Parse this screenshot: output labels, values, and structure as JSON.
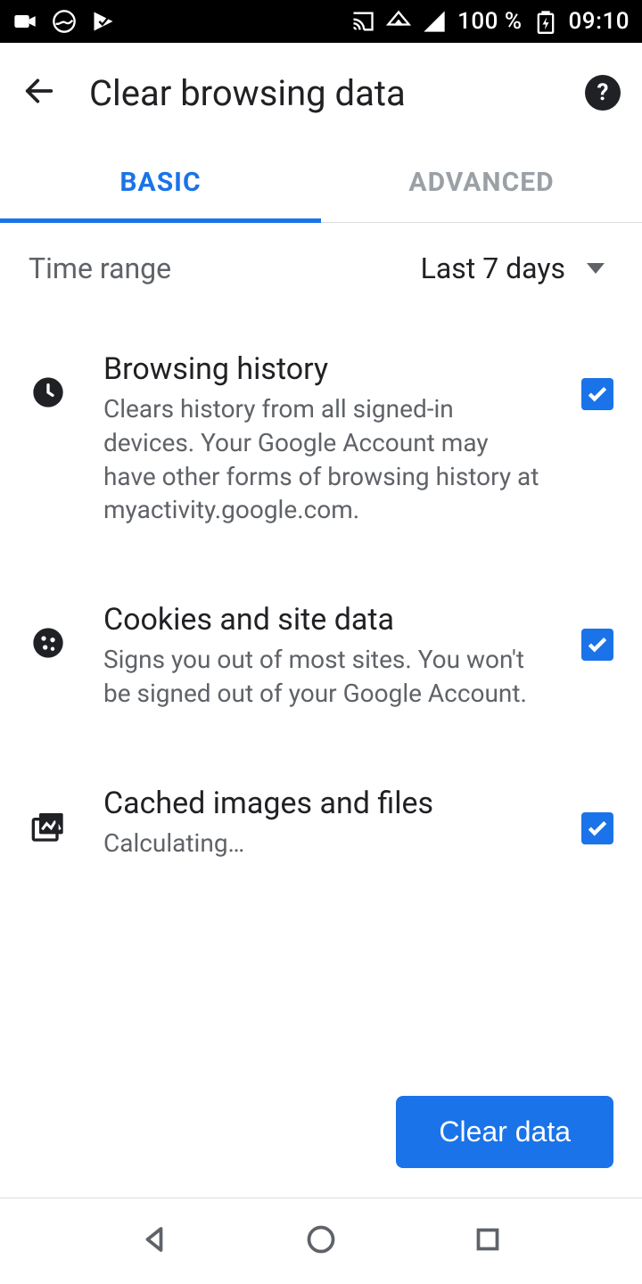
{
  "status": {
    "battery": "100 %",
    "time": "09:10"
  },
  "header": {
    "title": "Clear browsing data"
  },
  "tabs": {
    "basic": "BASIC",
    "advanced": "ADVANCED"
  },
  "time_range": {
    "label": "Time range",
    "value": "Last 7 days"
  },
  "options": {
    "browsing_history": {
      "title": "Browsing history",
      "desc": "Clears history from all signed-in devices. Your Google Account may have other forms of browsing history at myactivity.google.com."
    },
    "cookies": {
      "title": "Cookies and site data",
      "desc": "Signs you out of most sites. You won't be signed out of your Google Account."
    },
    "cache": {
      "title": "Cached images and files",
      "desc": "Calculating…"
    }
  },
  "actions": {
    "clear": "Clear data"
  }
}
